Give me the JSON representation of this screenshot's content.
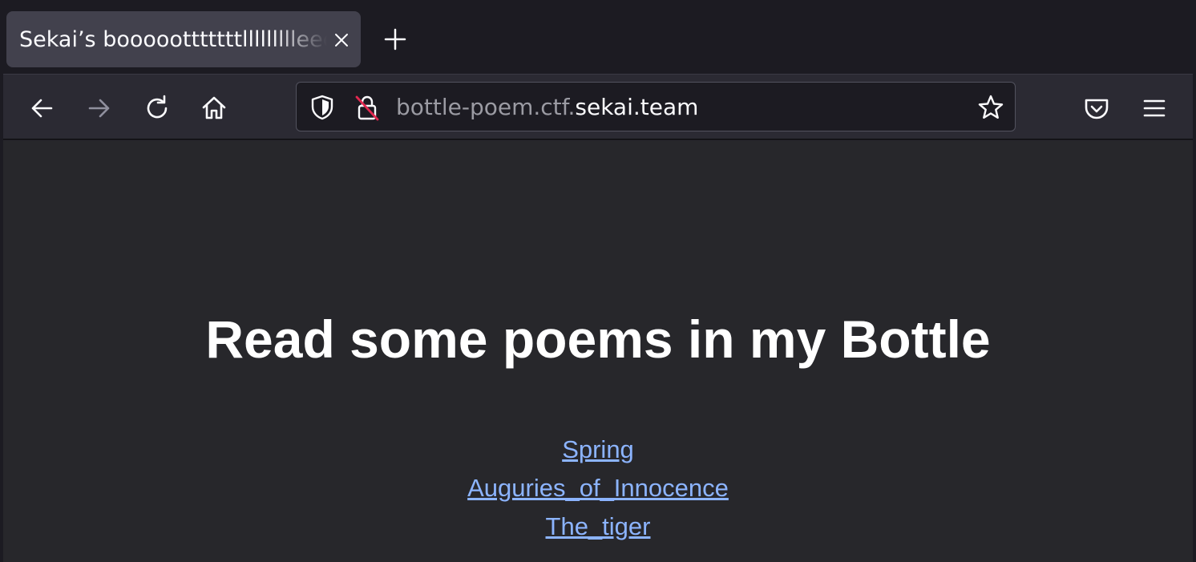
{
  "browser": {
    "tabs": [
      {
        "title": "Sekai’s boooootttttttllllllllleeeeee"
      }
    ],
    "new_tab_icon": "plus-icon",
    "close_tab_icon": "close-icon",
    "url": {
      "prefix": "bottle-poem.ctf.",
      "host": "sekai.team"
    },
    "nav_icons": [
      "back-arrow-icon",
      "forward-arrow-icon",
      "reload-icon",
      "home-icon"
    ],
    "url_icons": [
      "shield-icon",
      "insecure-lock-icon",
      "star-icon"
    ],
    "toolbar_icons": [
      "pocket-icon",
      "hamburger-menu-icon"
    ],
    "colors": {
      "tab_active": "#42414d",
      "toolbar": "#2b2a33",
      "content_bg": "#27272b",
      "link": "#8cb4ff",
      "insecure_slash": "#e22850"
    }
  },
  "page": {
    "heading": "Read some poems in my Bottle",
    "links": [
      {
        "label": "Spring"
      },
      {
        "label": "Auguries_of_Innocence"
      },
      {
        "label": "The_tiger"
      }
    ]
  }
}
